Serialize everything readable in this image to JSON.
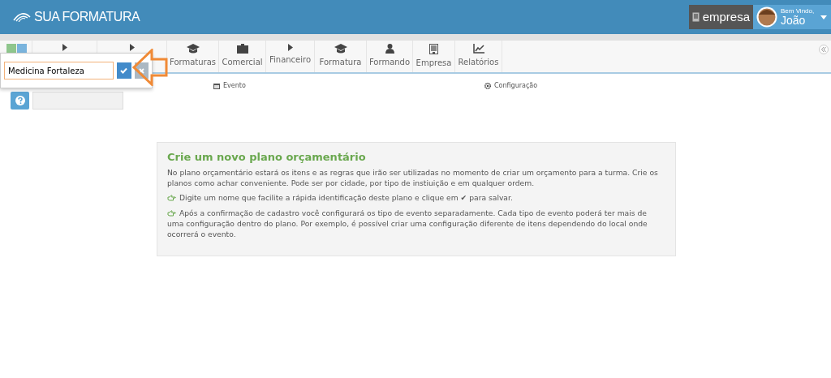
{
  "header": {
    "brand": "SUA FORMATURA",
    "company": "empresa",
    "welcome": "Bem Vindo,",
    "user": "João"
  },
  "nav": {
    "tabs": [
      {
        "label": "Formaturas"
      },
      {
        "label": "Comercial"
      },
      {
        "label": "Financeiro"
      },
      {
        "label": "Formatura"
      },
      {
        "label": "Formando"
      },
      {
        "label": "Empresa"
      },
      {
        "label": "Relatórios"
      }
    ]
  },
  "sub_links": [
    {
      "label": "Evento"
    },
    {
      "label": "Configuração"
    }
  ],
  "popover": {
    "value": "Medicina Fortaleza"
  },
  "panel": {
    "title": "Crie um novo plano orçamentário",
    "intro": "No plano orçamentário estará os itens e as regras que irão ser utilizadas no momento de criar um orçamento para a turma. Crie os planos como achar conveniente. Pode ser por cidade, por tipo de instiuição e em qualquer ordem.",
    "tips": [
      "Digite um nome que facilite a rápida identificação deste plano e clique em ✔ para salvar.",
      "Após a confirmação de cadastro você configurará os tipo de evento separadamente. Cada tipo de evento poderá ter mais de uma configuração dentro do plano. Por exemplo, é possível criar uma configuração diferente de itens dependendo do local onde ocorrerá o evento."
    ]
  }
}
